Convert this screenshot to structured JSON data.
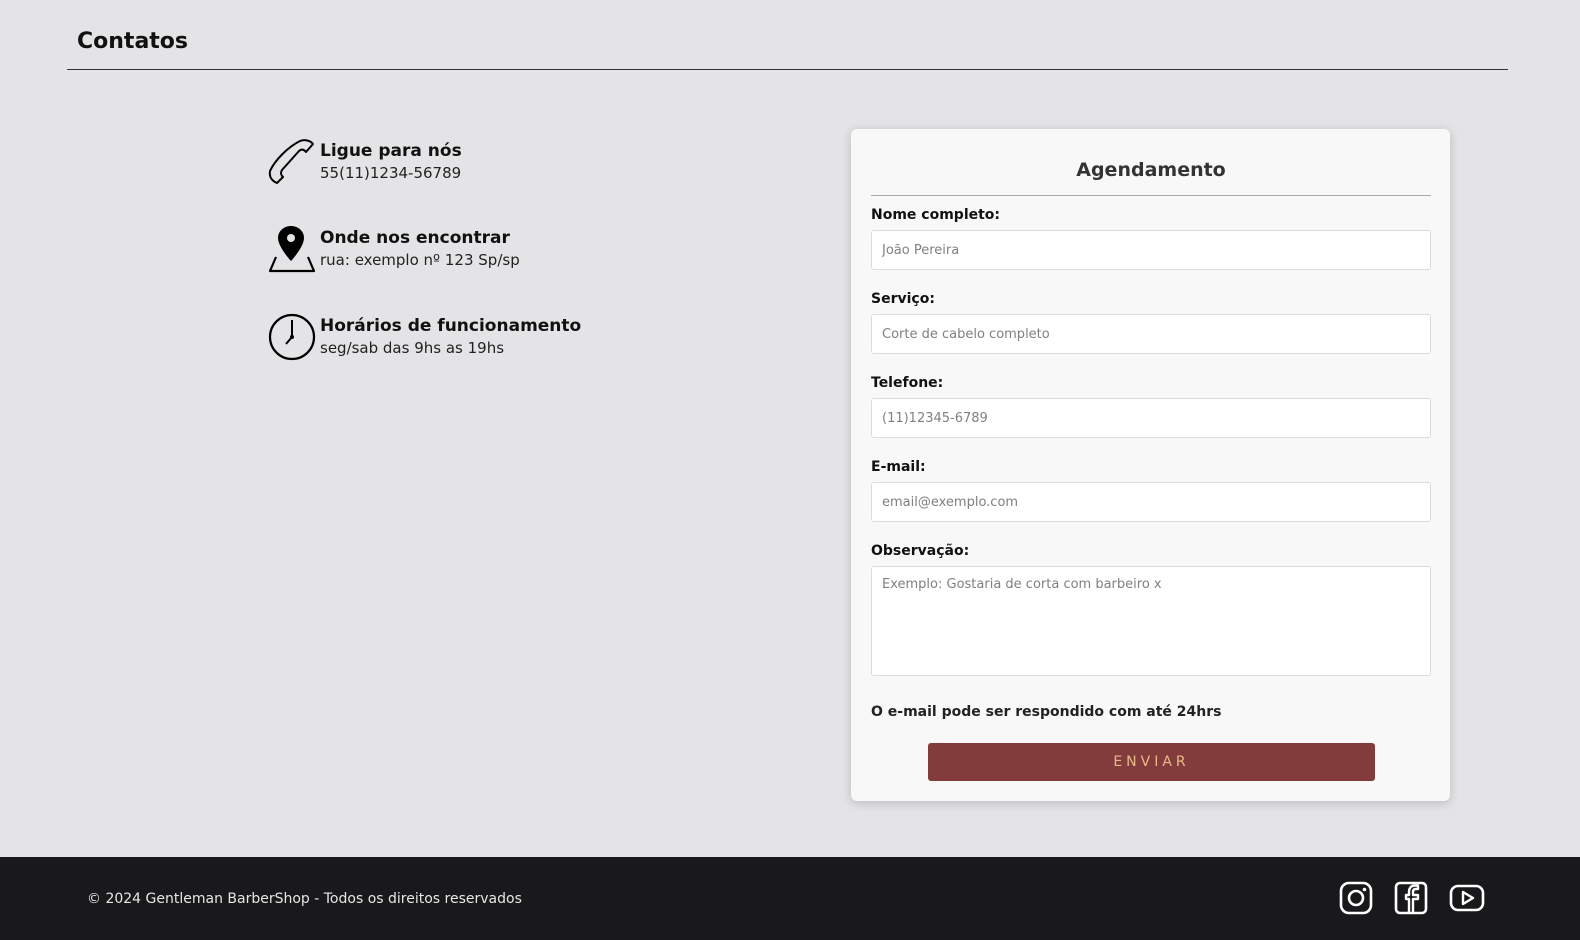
{
  "page": {
    "title": "Contatos"
  },
  "contacts": [
    {
      "icon": "phone-icon",
      "title": "Ligue para nós",
      "value": "55(11)1234-56789"
    },
    {
      "icon": "map-pin-icon",
      "title": "Onde nos encontrar",
      "value": "rua: exemplo nº 123 Sp/sp"
    },
    {
      "icon": "clock-icon",
      "title": "Horários de funcionamento",
      "value": "seg/sab das 9hs as 19hs"
    }
  ],
  "form": {
    "title": "Agendamento",
    "fields": [
      {
        "label": "Nome completo:",
        "placeholder": "João Pereira"
      },
      {
        "label": "Serviço:",
        "placeholder": "Corte de cabelo completo"
      },
      {
        "label": "Telefone:",
        "placeholder": "(11)12345-6789"
      },
      {
        "label": "E-mail:",
        "placeholder": "email@exemplo.com"
      },
      {
        "label": "Observação:",
        "placeholder": "Exemplo: Gostaria de corta com barbeiro x"
      }
    ],
    "note": "O e-mail pode ser respondido com até 24hrs",
    "submit_label": "ENVIAR"
  },
  "footer": {
    "copyright": "© 2024 Gentleman BarberShop - Todos os direitos reservados",
    "social": [
      "instagram-icon",
      "facebook-icon",
      "youtube-icon"
    ]
  },
  "colors": {
    "background": "#e4e4e6",
    "button": "#833c3c",
    "button_text": "#e9b98a",
    "footer": "#19191b"
  }
}
